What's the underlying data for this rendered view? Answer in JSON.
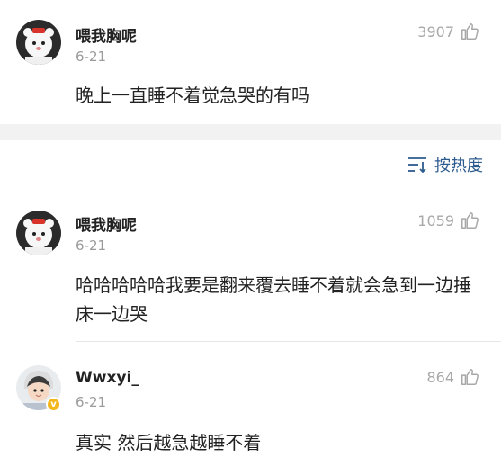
{
  "post": {
    "username": "喂我胸呢",
    "date": "6-21",
    "likes": "3907",
    "content": "晚上一直睡不着觉急哭的有吗"
  },
  "sort": {
    "label": "按热度"
  },
  "comments": [
    {
      "username": "喂我胸呢",
      "date": "6-21",
      "likes": "1059",
      "content": "哈哈哈哈哈我要是翻来覆去睡不着就会急到一边捶床一边哭"
    },
    {
      "username": "Wwxyi_",
      "date": "6-21",
      "likes": "864",
      "badge": "v",
      "content": "真实 然后越急越睡不着"
    }
  ],
  "colors": {
    "accent": "#2d5b8f",
    "muted": "#9a9a9a",
    "badge": "#f3b71c"
  }
}
